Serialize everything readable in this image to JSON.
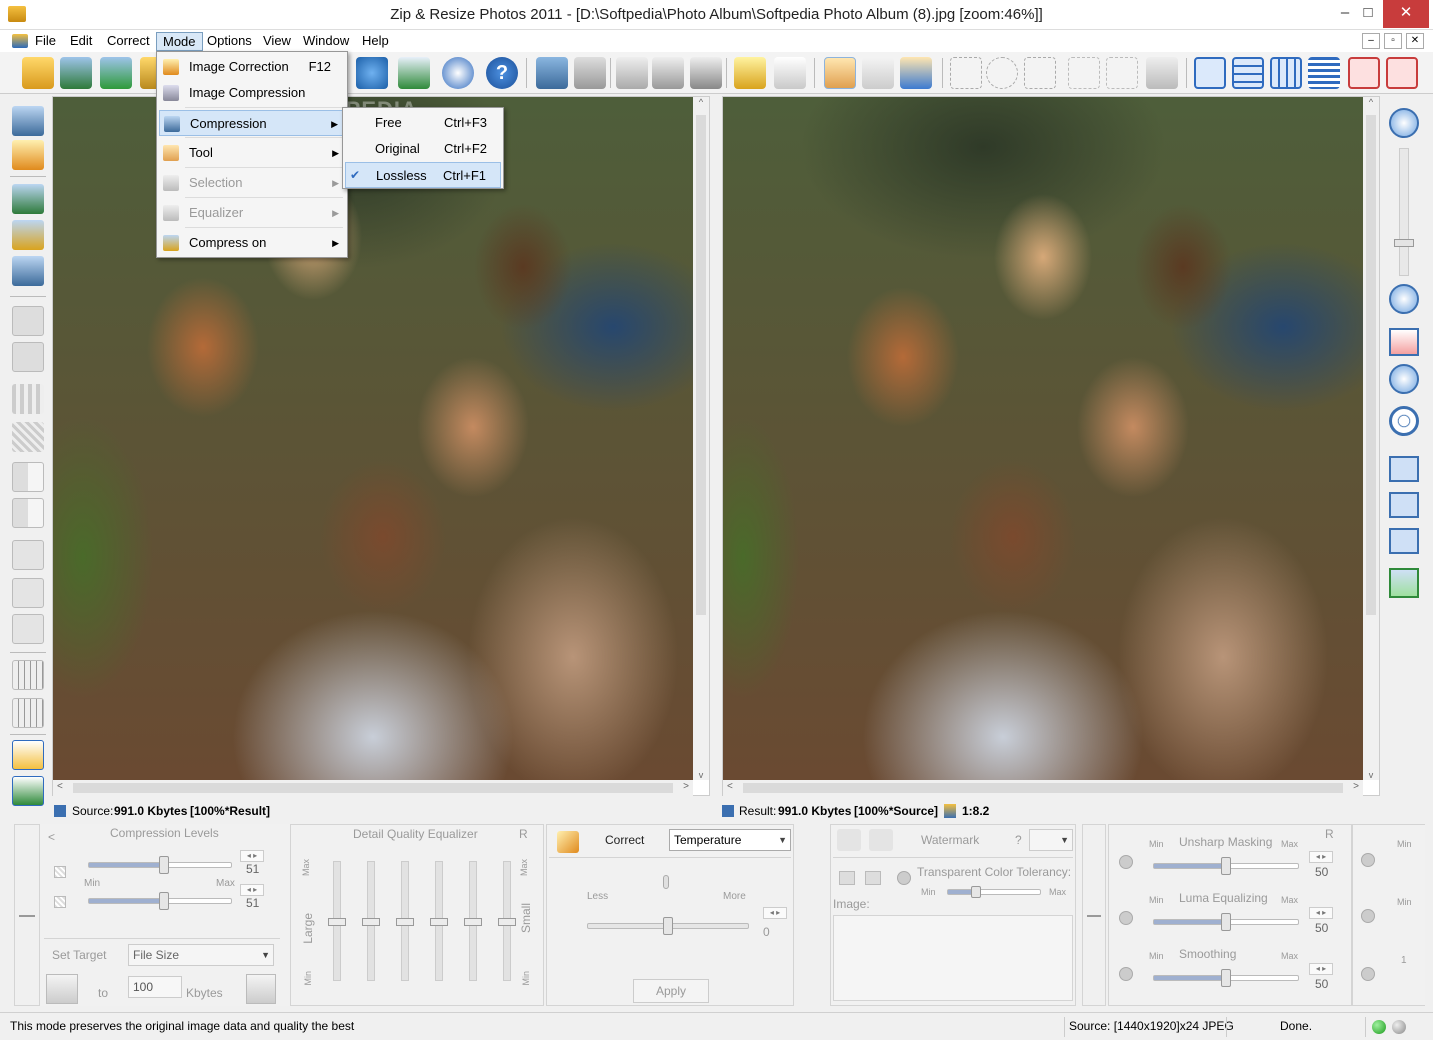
{
  "window": {
    "title": "Zip & Resize Photos 2011 - [D:\\Softpedia\\Photo Album\\Softpedia Photo Album (8).jpg  [zoom:46%]]",
    "minimize": "–",
    "maximize": "□",
    "close": "✕",
    "child_minimize": "–",
    "child_restore": "▫",
    "child_close": "✕"
  },
  "menubar": [
    "File",
    "Edit",
    "Correct",
    "Mode",
    "Options",
    "View",
    "Window",
    "Help"
  ],
  "mode_menu": {
    "items": [
      {
        "label": "Image Correction",
        "shortcut": "F12",
        "icon": "wrench-icon"
      },
      {
        "label": "Image Compression",
        "shortcut": "",
        "icon": "compress-icon"
      },
      {
        "label": "Compression",
        "shortcut": "",
        "icon": "compression-icon",
        "submenu": true,
        "highlighted": true
      },
      {
        "label": "Tool",
        "shortcut": "",
        "icon": "hand-icon",
        "submenu": true
      },
      {
        "label": "Selection",
        "shortcut": "",
        "icon": "selection-icon",
        "submenu": true,
        "disabled": true
      },
      {
        "label": "Equalizer",
        "shortcut": "",
        "icon": "equalizer-icon",
        "submenu": true,
        "disabled": true
      },
      {
        "label": "Compress on",
        "shortcut": "",
        "icon": "compress-on-icon",
        "submenu": true
      }
    ]
  },
  "compression_submenu": [
    {
      "label": "Free",
      "shortcut": "Ctrl+F3",
      "checked": false
    },
    {
      "label": "Original",
      "shortcut": "Ctrl+F2",
      "checked": false
    },
    {
      "label": "Lossless",
      "shortcut": "Ctrl+F1",
      "checked": true
    }
  ],
  "source_status": {
    "prefix": "Source:",
    "size": "991.0 Kbytes",
    "ratio": "[100%*Result]"
  },
  "result_status": {
    "prefix": "Result:",
    "size": "991.0 Kbytes",
    "ratio": "[100%*Source]",
    "compression": "1:8.2"
  },
  "compression_levels": {
    "title": "Compression Levels",
    "top_value": "51",
    "bottom_value": "51",
    "min": "Min",
    "max": "Max",
    "top_level": 0.53,
    "bottom_level": 0.53
  },
  "set_target": {
    "label": "Set Target",
    "mode": "File Size",
    "to": "to",
    "value": "100",
    "unit": "Kbytes"
  },
  "equalizer": {
    "title": "Detail Quality Equalizer",
    "r": "R",
    "large": "Large",
    "small": "Small",
    "max": "Max",
    "min": "Min",
    "levels": [
      0.5,
      0.5,
      0.5,
      0.5,
      0.5,
      0.5
    ]
  },
  "correct": {
    "label": "Correct",
    "selected": "Temperature",
    "less": "Less",
    "more": "More",
    "value": "0",
    "apply": "Apply",
    "level": 0.5
  },
  "watermark": {
    "label": "Watermark",
    "question": "?",
    "tolerance": "Transparent Color Tolerancy:",
    "min": "Min",
    "max": "Max",
    "image": "Image:",
    "tolerance_level": 0.3
  },
  "filters": {
    "r": "R",
    "items": [
      {
        "name": "Unsharp Masking",
        "value": "50",
        "min": "Min",
        "max": "Max",
        "level": 0.5
      },
      {
        "name": "Luma Equalizing",
        "value": "50",
        "min": "Min",
        "max": "Max",
        "level": 0.5
      },
      {
        "name": "Smoothing",
        "value": "50",
        "min": "Min",
        "max": "Max",
        "level": 0.5
      }
    ],
    "extra_min": "Min",
    "extra_one": "1"
  },
  "statusbar": {
    "message": "This mode preserves the original image data and quality the best",
    "source": "Source: [1440x1920]x24 JPEG",
    "state": "Done."
  },
  "watermark_text": "SOFTPEDIA",
  "colors": {
    "menu_highlight": "#d5e6f8",
    "accent": "#2f6bbf",
    "status_green": "#2fb52f"
  }
}
